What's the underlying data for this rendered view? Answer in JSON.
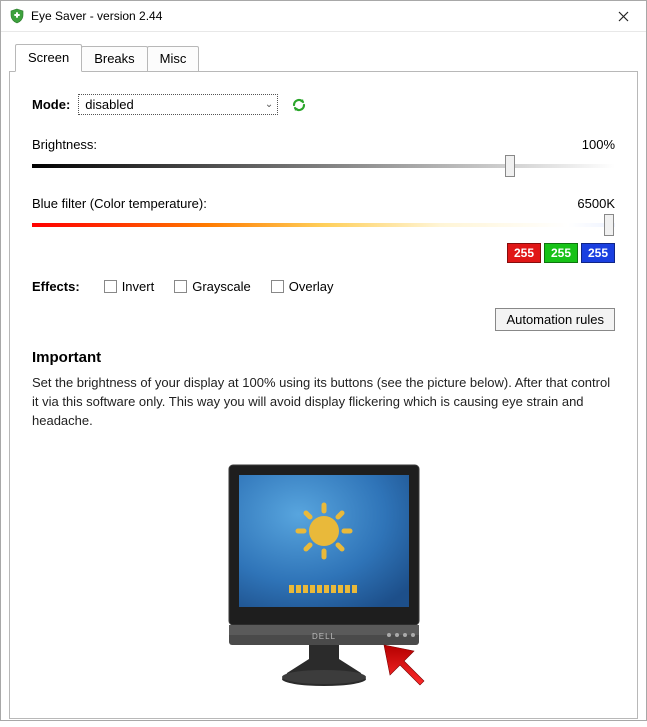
{
  "window": {
    "title": "Eye Saver - version 2.44"
  },
  "tabs": {
    "screen": "Screen",
    "breaks": "Breaks",
    "misc": "Misc"
  },
  "mode": {
    "label": "Mode:",
    "value": "disabled"
  },
  "brightness": {
    "label": "Brightness:",
    "value": "100%",
    "percent": 82
  },
  "bluefilter": {
    "label": "Blue filter (Color temperature):",
    "value": "6500K",
    "percent": 99
  },
  "rgb": {
    "r": "255",
    "g": "255",
    "b": "255"
  },
  "effects": {
    "label": "Effects:",
    "invert": "Invert",
    "grayscale": "Grayscale",
    "overlay": "Overlay"
  },
  "automation_button": "Automation rules",
  "important": {
    "heading": "Important",
    "text": "Set the brightness of your display at 100% using its buttons (see the picture below). After that control it via this software only. This way you will avoid display flickering which is causing eye strain and headache."
  }
}
